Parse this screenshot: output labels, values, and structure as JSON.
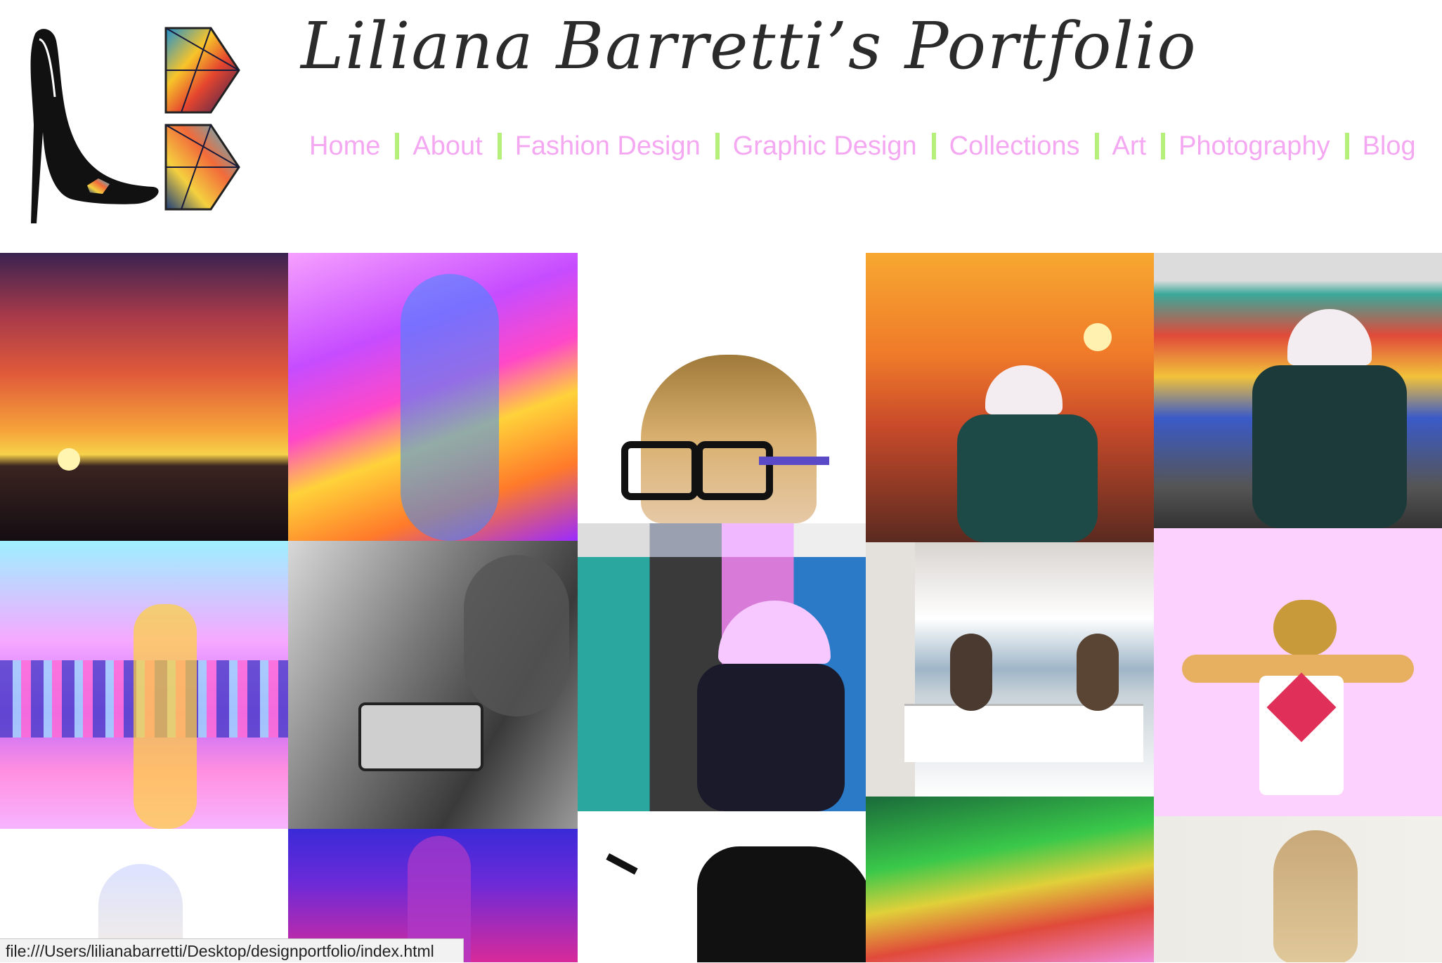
{
  "site": {
    "title": "Liliana Barretti’s Portfolio",
    "logo_icon": "stiletto-shoe-and-geometric-b-logo"
  },
  "nav": {
    "items": [
      "Home",
      "About",
      "Fashion Design",
      "Graphic Design",
      "Collections",
      "Art",
      "Photography",
      "Blog"
    ],
    "text_color": "#f5a8f2",
    "separator_color": "#b5f07a"
  },
  "gallery": {
    "tiles": [
      {
        "name": "sunset-over-sea"
      },
      {
        "name": "neon-double-exposure-selfie"
      },
      {
        "name": "braided-hair-glasses-portrait"
      },
      {
        "name": "city-sunset-cap-portrait"
      },
      {
        "name": "graffiti-wall-cap-portrait"
      },
      {
        "name": "city-skyline-double-exposure"
      },
      {
        "name": "black-white-truck-collage"
      },
      {
        "name": "graffiti-split-color-portrait"
      },
      {
        "name": "balcony-ocean-friends"
      },
      {
        "name": "pink-hands-over-face"
      },
      {
        "name": "white-bright-hair"
      },
      {
        "name": "blue-purple-silhouette"
      },
      {
        "name": "airplane-silhouette-skyline"
      },
      {
        "name": "green-red-sky-wires"
      },
      {
        "name": "ponytail-back-view"
      }
    ]
  },
  "status_bar": {
    "url": "file:///Users/lilianabarretti/Desktop/designportfolio/index.html"
  }
}
